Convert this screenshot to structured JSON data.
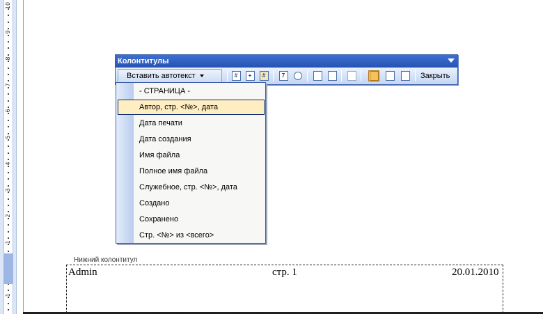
{
  "ruler": {
    "numbers": [
      "10",
      "9",
      "8",
      "7",
      "6",
      "5",
      "4",
      "3",
      "2",
      "1",
      "1"
    ]
  },
  "toolbar": {
    "title": "Колонтитулы",
    "insert_autotext_label": "Вставить автотекст",
    "close_label": "Закрыть",
    "icons": [
      "insert-page-number-icon",
      "insert-page-count-icon",
      "format-page-number-icon",
      "insert-date-icon",
      "insert-time-icon",
      "page-setup-icon",
      "show-hide-text-icon",
      "same-as-previous-icon",
      "switch-header-footer-icon",
      "show-previous-icon",
      "show-next-icon"
    ]
  },
  "autotext_menu": {
    "items": [
      "- СТРАНИЦА -",
      "Автор, стр. <№>, дата",
      "Дата печати",
      "Дата создания",
      "Имя файла",
      "Полное имя файла",
      "Служебное, стр. <№>, дата",
      "Создано",
      "Сохранено",
      "Стр. <№> из <всего>"
    ],
    "selected_index": 1
  },
  "footer": {
    "label": "Нижний колонтитул",
    "left_text": "Admin",
    "center_text": "стр. 1",
    "right_text": "20.01.2010"
  },
  "colors": {
    "toolbar_title_bg": "#2f5fc4",
    "toolbar_bg": "#c7d9f4",
    "menu_selected_bg": "#ffeec2",
    "active_tool_bg": "#ffd48a"
  }
}
